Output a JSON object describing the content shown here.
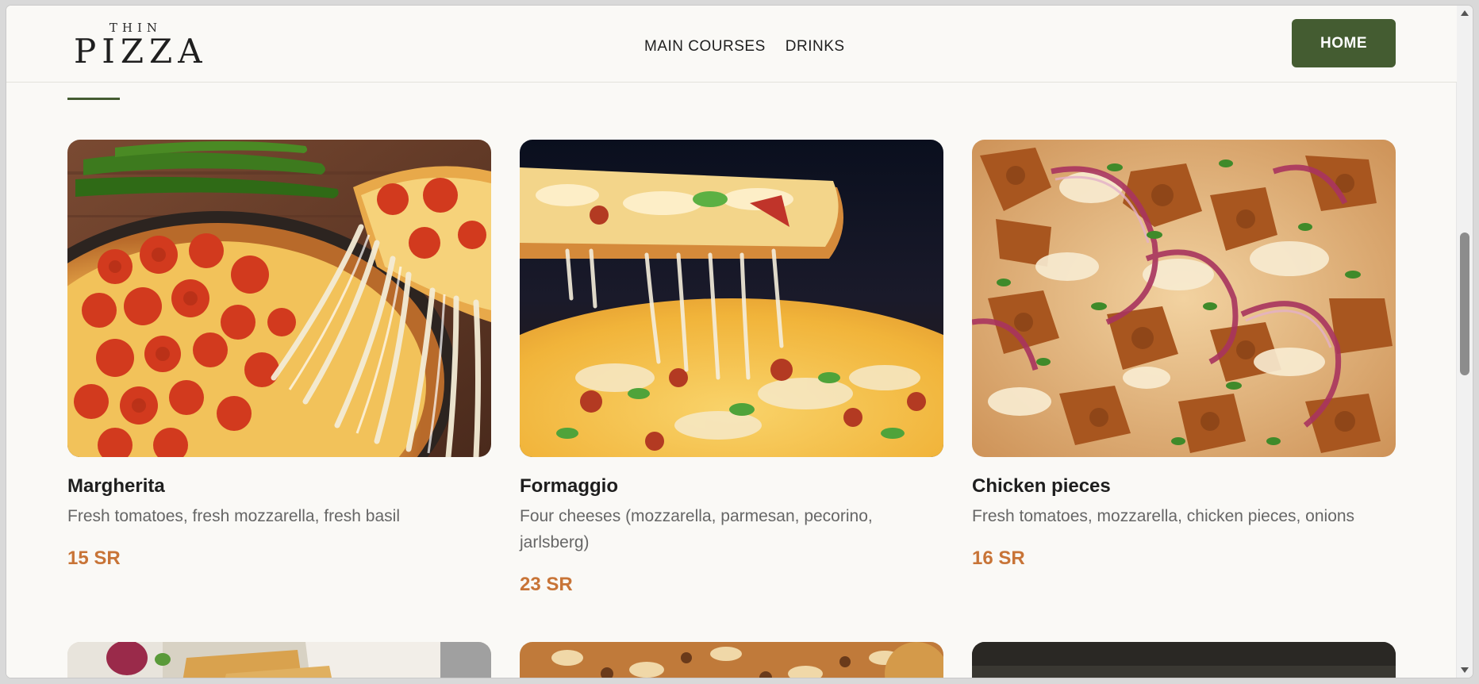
{
  "header": {
    "logo_top": "THIN",
    "logo_main": "PIZZA",
    "nav": [
      "MAIN COURSES",
      "DRINKS"
    ],
    "home_button": "HOME"
  },
  "menu": {
    "items": [
      {
        "name": "Margherita",
        "description": "Fresh tomatoes, fresh mozzarella, fresh basil",
        "price": "15 SR",
        "image": "pepperoni-pizza-image"
      },
      {
        "name": "Formaggio",
        "description": "Four cheeses (mozzarella, parmesan, pecorino, jarlsberg)",
        "price": "23 SR",
        "image": "cheese-pizza-slice-image"
      },
      {
        "name": "Chicken pieces",
        "description": "Fresh tomatoes, mozzarella, chicken pieces, onions",
        "price": "16 SR",
        "image": "chicken-pizza-image"
      }
    ]
  },
  "colors": {
    "accent_green": "#445c31",
    "price_orange": "#c87437",
    "background": "#faf9f6"
  }
}
